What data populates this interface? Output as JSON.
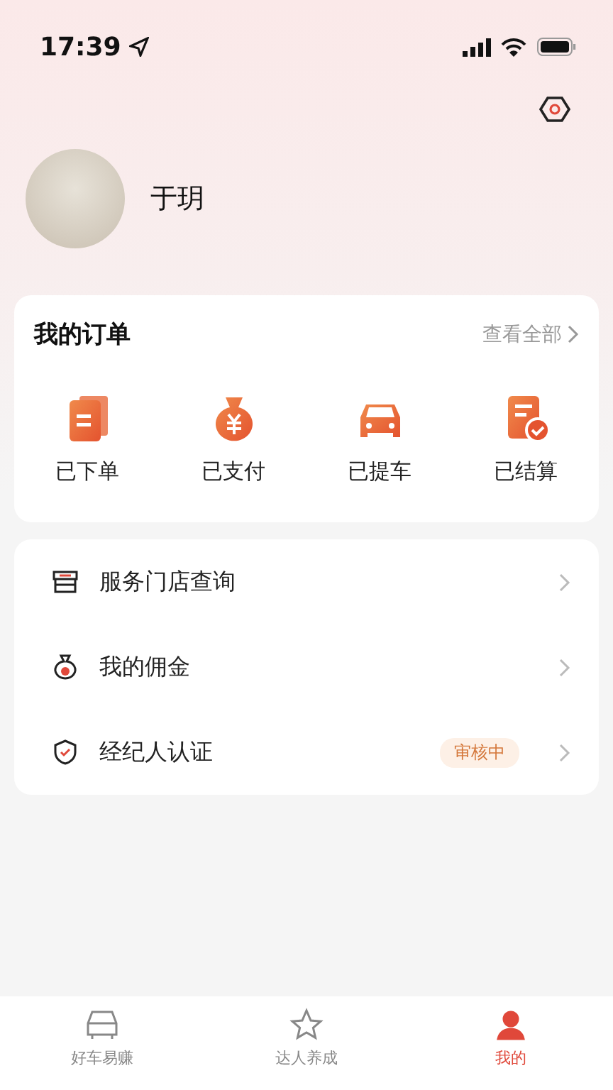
{
  "status_bar": {
    "time": "17:39"
  },
  "profile": {
    "name": "于玥"
  },
  "orders": {
    "title": "我的订单",
    "view_all": "查看全部",
    "items": [
      {
        "kind": "placed",
        "label": "已下单"
      },
      {
        "kind": "paid",
        "label": "已支付"
      },
      {
        "kind": "pickup",
        "label": "已提车"
      },
      {
        "kind": "settled",
        "label": "已结算"
      }
    ]
  },
  "menu": [
    {
      "kind": "store",
      "label": "服务门店查询"
    },
    {
      "kind": "commission",
      "label": "我的佣金"
    },
    {
      "kind": "verify",
      "label": "经纪人认证",
      "badge": "审核中"
    }
  ],
  "tab_bar": [
    {
      "kind": "car",
      "label": "好车易赚",
      "selected": false
    },
    {
      "kind": "star",
      "label": "达人养成",
      "selected": false
    },
    {
      "kind": "user",
      "label": "我的",
      "selected": true
    }
  ]
}
